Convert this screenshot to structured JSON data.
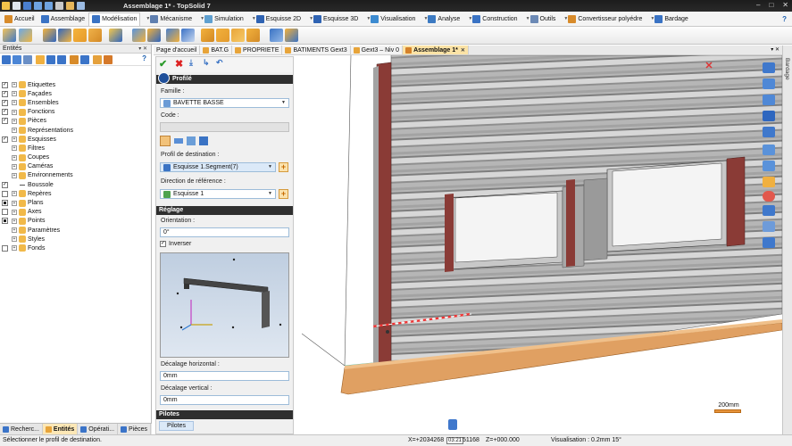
{
  "window": {
    "title": "Assemblage 1* - TopSolid 7",
    "controls": [
      "–",
      "□",
      "✕"
    ]
  },
  "menu": {
    "tabs": [
      {
        "label": "Accueil",
        "color": "#d88b2a",
        "active": false
      },
      {
        "label": "Assemblage",
        "color": "#3a73c4",
        "active": false
      },
      {
        "label": "Modélisation",
        "color": "#3a73c4",
        "active": true
      },
      {
        "label": "Mécanisme",
        "color": "#5f7fb0",
        "active": false
      },
      {
        "label": "Simulation",
        "color": "#5fa0d0",
        "active": false
      },
      {
        "label": "Esquisse 2D",
        "color": "#2f63b3",
        "active": false
      },
      {
        "label": "Esquisse 3D",
        "color": "#2f63b3",
        "active": false
      },
      {
        "label": "Visualisation",
        "color": "#3c8bd1",
        "active": false
      },
      {
        "label": "Analyse",
        "color": "#3c7ac2",
        "active": false
      },
      {
        "label": "Construction",
        "color": "#3a73c4",
        "active": false
      },
      {
        "label": "Outils",
        "color": "#6c8ab6",
        "active": false
      },
      {
        "label": "Convertisseur polyédre",
        "color": "#d88b2a",
        "active": false
      },
      {
        "label": "Bardage",
        "color": "#3a73c4",
        "active": false
      }
    ],
    "help": "?"
  },
  "entities_panel": {
    "title": "Entités",
    "pin": "▾ ✕",
    "help": "?",
    "items": [
      {
        "label": "Etiquettes",
        "check": "tick"
      },
      {
        "label": "Façades",
        "check": "tick"
      },
      {
        "label": "Ensembles",
        "check": "tick"
      },
      {
        "label": "Fonctions",
        "check": "tick"
      },
      {
        "label": "Pièces",
        "check": "tick"
      },
      {
        "label": "Représentations",
        "check": "none"
      },
      {
        "label": "Esquisses",
        "check": "tick"
      },
      {
        "label": "Filtres",
        "check": "none"
      },
      {
        "label": "Coupes",
        "check": "none"
      },
      {
        "label": "Caméras",
        "check": "none"
      },
      {
        "label": "Environnements",
        "check": "none"
      },
      {
        "label": "Boussole",
        "check": "tick"
      },
      {
        "label": "Repères",
        "check": "empty"
      },
      {
        "label": "Plans",
        "check": "filled"
      },
      {
        "label": "Axes",
        "check": "empty"
      },
      {
        "label": "Points",
        "check": "filled"
      },
      {
        "label": "Paramètres",
        "check": "none"
      },
      {
        "label": "Styles",
        "check": "none"
      },
      {
        "label": "Fonds",
        "check": "empty"
      }
    ]
  },
  "left_tabs": [
    {
      "label": "Recherc...",
      "active": false
    },
    {
      "label": "Entités",
      "active": true
    },
    {
      "label": "Opérati...",
      "active": false
    },
    {
      "label": "Pièces",
      "active": false
    }
  ],
  "doc_tabs": [
    {
      "label": "Page d'accueil",
      "active": false
    },
    {
      "label": "BAT.G",
      "active": false
    },
    {
      "label": "PROPRIETE",
      "active": false
    },
    {
      "label": "BATIMENTS Gext3",
      "active": false
    },
    {
      "label": "Gext3 – Niv 0",
      "active": false
    },
    {
      "label": "Assemblage 1*",
      "active": true
    }
  ],
  "doc_tabs_pin": "▾ ✕",
  "right_dock_label": "Bardage",
  "property_panel": {
    "section_profile": "Profilé",
    "famille_label": "Famille :",
    "famille_value": "BAVETTE BASSE",
    "code_label": "Code :",
    "profil_label": "Profil de destination :",
    "profil_value": "Esquisse 1.Segment(7)",
    "direction_label": "Direction de référence :",
    "direction_value": "Esquisse 1",
    "section_reglage": "Réglage",
    "orientation_label": "Orientation :",
    "orientation_value": "0°",
    "inverser_label": "Inverser",
    "inverser_checked": true,
    "decalage_h_label": "Décalage horizontal :",
    "decalage_h_value": "0mm",
    "decalage_v_label": "Décalage vertical :",
    "decalage_v_value": "0mm",
    "section_pilotes": "Pilotes",
    "pilotes_tab": "Pilotes"
  },
  "viewport": {
    "scale_label": "200mm"
  },
  "status": {
    "message": "Sélectionner le profil de destination.",
    "x_readout": "X=+2034268",
    "box_value": "03:21",
    "y_readout": "51168",
    "z_readout": "Z=+000.000",
    "visualisation": "Visualisation : 0.2mm 15°"
  },
  "colors": {
    "siding": "#b9b9b9",
    "frame": "#8a3b36",
    "bavette": "#e0a062",
    "accent_tab": "#fbe3a6"
  }
}
